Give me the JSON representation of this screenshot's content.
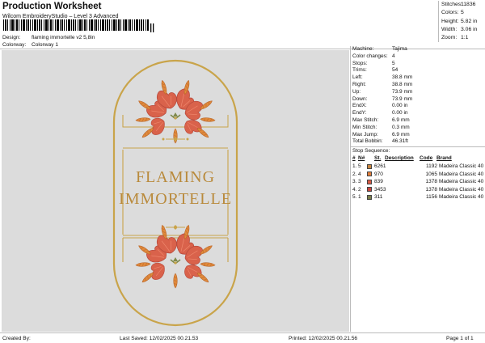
{
  "header": {
    "title": "Production Worksheet",
    "subtitle": "Wilcom EmbroideryStudio – Level 3 Advanced",
    "design_label": "Design:",
    "design_value": "flaming immortelle v2 5,8in",
    "colorway_label": "Colorway:",
    "colorway_value": "Colorway 1"
  },
  "stats": [
    {
      "label": "Stitches:",
      "value": "11836"
    },
    {
      "label": "Colors:",
      "value": "5"
    },
    {
      "label": "Height:",
      "value": "5.82 in"
    },
    {
      "label": "Width:",
      "value": "3.06 in"
    },
    {
      "label": "Zoom:",
      "value": "1:1"
    }
  ],
  "design_text": {
    "line1": "FLAMING",
    "line2": "IMMORTELLE"
  },
  "params": [
    {
      "label": "Machine:",
      "value": "Tajima"
    },
    {
      "label": "Color changes:",
      "value": "4"
    },
    {
      "label": "Stops:",
      "value": "5"
    },
    {
      "label": "Trims:",
      "value": "54"
    },
    {
      "label": "Left:",
      "value": "38.8 mm"
    },
    {
      "label": "Right:",
      "value": "38.8 mm"
    },
    {
      "label": "Up:",
      "value": "73.9 mm"
    },
    {
      "label": "Down:",
      "value": "73.9 mm"
    },
    {
      "label": "EndX:",
      "value": "0.00 in"
    },
    {
      "label": "EndY:",
      "value": "0.00 in"
    },
    {
      "label": "Max Stitch:",
      "value": "6.9 mm"
    },
    {
      "label": "Min Stitch:",
      "value": "0.3 mm"
    },
    {
      "label": "Max Jump:",
      "value": "6.9 mm"
    },
    {
      "label": "Total Bobbin:",
      "value": "46.31ft"
    }
  ],
  "stop_sequence": {
    "title": "Stop Sequence:",
    "headers": {
      "num": "#",
      "n": "N#",
      "st": "St.",
      "desc": "Description",
      "code": "Code",
      "brand": "Brand"
    },
    "rows": [
      {
        "num": "1.",
        "n": "5",
        "color": "#c9863e",
        "code": "6261",
        "stitches": "1192",
        "brand": "Madeira Classic 40"
      },
      {
        "num": "2.",
        "n": "4",
        "color": "#e07d3a",
        "code": "970",
        "stitches": "1065",
        "brand": "Madeira Classic 40"
      },
      {
        "num": "3.",
        "n": "3",
        "color": "#d65a45",
        "code": "839",
        "stitches": "1378",
        "brand": "Madeira Classic 40"
      },
      {
        "num": "4.",
        "n": "2",
        "color": "#c8463e",
        "code": "3453",
        "stitches": "1378",
        "brand": "Madeira Classic 40"
      },
      {
        "num": "5.",
        "n": "1",
        "color": "#7a7f4a",
        "code": "311",
        "stitches": "1156",
        "brand": "Madeira Classic 40"
      }
    ]
  },
  "footer": {
    "created_by": "Created By:",
    "last_saved": "Last Saved: 12/02/2025 00.21.53",
    "printed": "Printed: 12/02/2025 00.21.56",
    "page": "Page 1 of 1"
  },
  "colors": {
    "gold": "#c9a44a",
    "text_gold": "#b98a3c",
    "petal": "#d9624b",
    "petal_dark": "#c04a3d",
    "carrot": "#e08a3c",
    "leaf": "#7f8a4c",
    "canvas_bg": "#dcdcdc"
  }
}
